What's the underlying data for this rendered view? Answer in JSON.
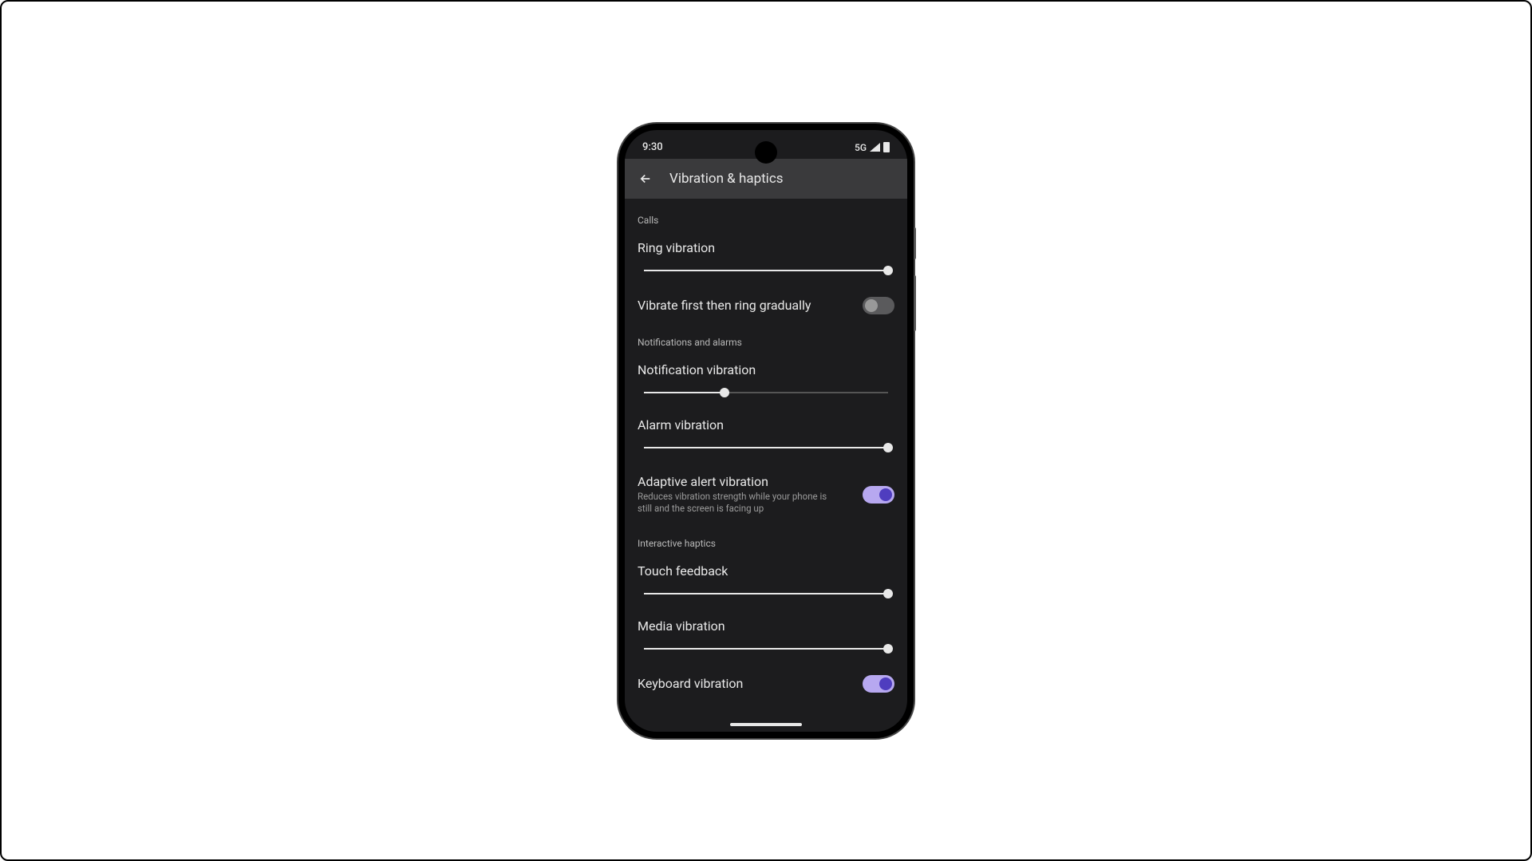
{
  "status": {
    "time": "9:30",
    "network": "5G"
  },
  "header": {
    "title": "Vibration & haptics"
  },
  "sections": {
    "calls": {
      "header": "Calls",
      "ring_vibration": {
        "label": "Ring vibration",
        "value": 100
      },
      "vibrate_first": {
        "label": "Vibrate first then ring gradually",
        "enabled": false
      }
    },
    "notifications": {
      "header": "Notifications and alarms",
      "notification_vibration": {
        "label": "Notification vibration",
        "value": 33
      },
      "alarm_vibration": {
        "label": "Alarm vibration",
        "value": 100
      },
      "adaptive": {
        "label": "Adaptive alert vibration",
        "description": "Reduces vibration strength while your phone is still and the screen is facing up",
        "enabled": true
      }
    },
    "interactive": {
      "header": "Interactive haptics",
      "touch_feedback": {
        "label": "Touch feedback",
        "value": 100
      },
      "media_vibration": {
        "label": "Media vibration",
        "value": 100
      },
      "keyboard_vibration": {
        "label": "Keyboard vibration",
        "enabled": true
      }
    }
  },
  "colors": {
    "background": "#1c1c1e",
    "appbar": "#3a3a3c",
    "accent_on_track": "#b7a8f0",
    "accent_on_knob": "#4f3dbf"
  }
}
